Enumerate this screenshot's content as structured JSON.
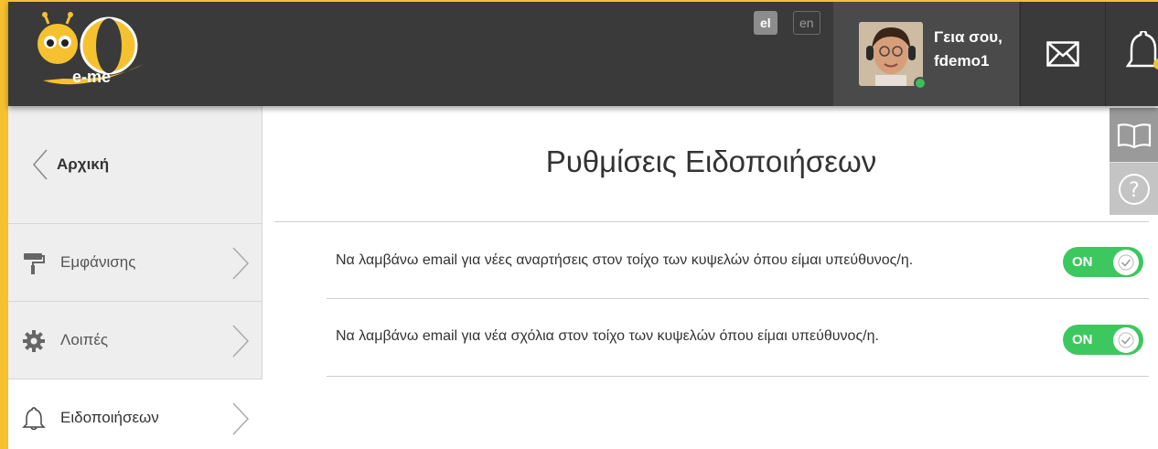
{
  "brand": {
    "logo_text": "e-me",
    "accent": "#f6c12f",
    "header_bg": "#3a3a3a"
  },
  "header": {
    "languages": [
      {
        "code": "el",
        "active": true
      },
      {
        "code": "en",
        "active": false
      }
    ],
    "user": {
      "greeting": "Γεια σου,",
      "username": "fdemo1",
      "status": "online",
      "status_color": "#3bbf5a"
    },
    "icons": {
      "mail": "envelope-icon",
      "notifications": "bell-icon"
    }
  },
  "sidebar": {
    "home_label": "Αρχική",
    "items": [
      {
        "label": "Εμφάνισης",
        "icon": "paint-roller-icon",
        "active": false
      },
      {
        "label": "Λοιπές",
        "icon": "gear-icon",
        "active": false
      },
      {
        "label": "Ειδοποιήσεων",
        "icon": "bell-icon",
        "active": true
      }
    ]
  },
  "side_tools": {
    "book": "book-icon",
    "help": "help-icon"
  },
  "main": {
    "title": "Ρυθμίσεις Ειδοποιήσεων",
    "settings": [
      {
        "text": "Να λαμβάνω email για νέες αναρτήσεις στον τοίχο των κυψελών όπου είμαι υπεύθυνος/η.",
        "toggle_label": "ON",
        "enabled": true
      },
      {
        "text": "Να λαμβάνω email για νέα σχόλια στον τοίχο των κυψελών όπου είμαι υπεύθυνος/η.",
        "toggle_label": "ON",
        "enabled": true
      }
    ],
    "toggle_color": "#3cc85e"
  }
}
